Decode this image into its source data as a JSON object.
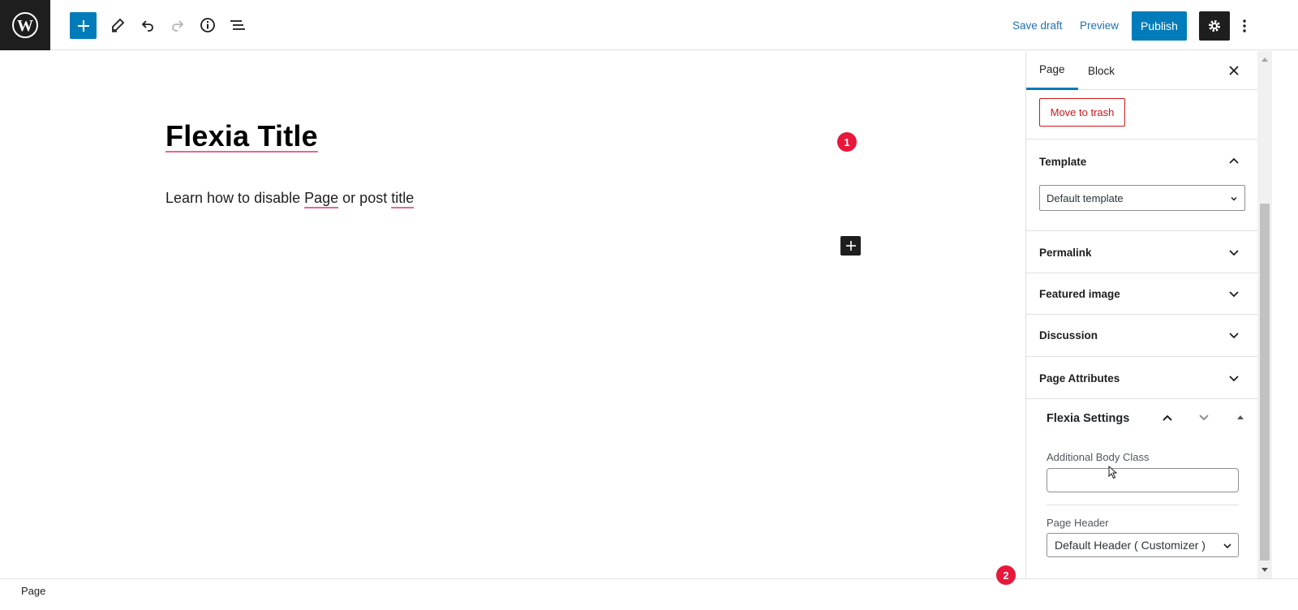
{
  "toolbar": {
    "save_draft": "Save draft",
    "preview": "Preview",
    "publish": "Publish",
    "icons": [
      "wordpress-icon",
      "plus-icon",
      "pencil-icon",
      "undo-icon",
      "redo-icon",
      "info-icon",
      "list-view-icon",
      "gear-icon",
      "more-vertical-icon"
    ]
  },
  "editor": {
    "title": "Flexia Title",
    "paragraph": {
      "part1": "Learn how to disable ",
      "word1": "Page",
      "part2": " or post ",
      "word2": "title"
    },
    "step_badge_1": "1",
    "step_badge_2": "2"
  },
  "sidebar": {
    "tabs": [
      "Page",
      "Block"
    ],
    "active_tab": "Page",
    "move_to_trash": "Move to trash",
    "template": {
      "title": "Template",
      "value": "Default template"
    },
    "panels": [
      "Permalink",
      "Featured image",
      "Discussion",
      "Page Attributes"
    ],
    "flexia": {
      "title": "Flexia Settings",
      "body_class_label": "Additional Body Class",
      "body_class_value": "",
      "page_header_label": "Page Header",
      "page_header_value": "Default Header ( Customizer )"
    }
  },
  "footer": {
    "breadcrumb": "Page"
  },
  "colors": {
    "accent": "#007cba",
    "danger": "#cc1818",
    "badge": "#e8173b",
    "dark": "#1e1e1e"
  }
}
